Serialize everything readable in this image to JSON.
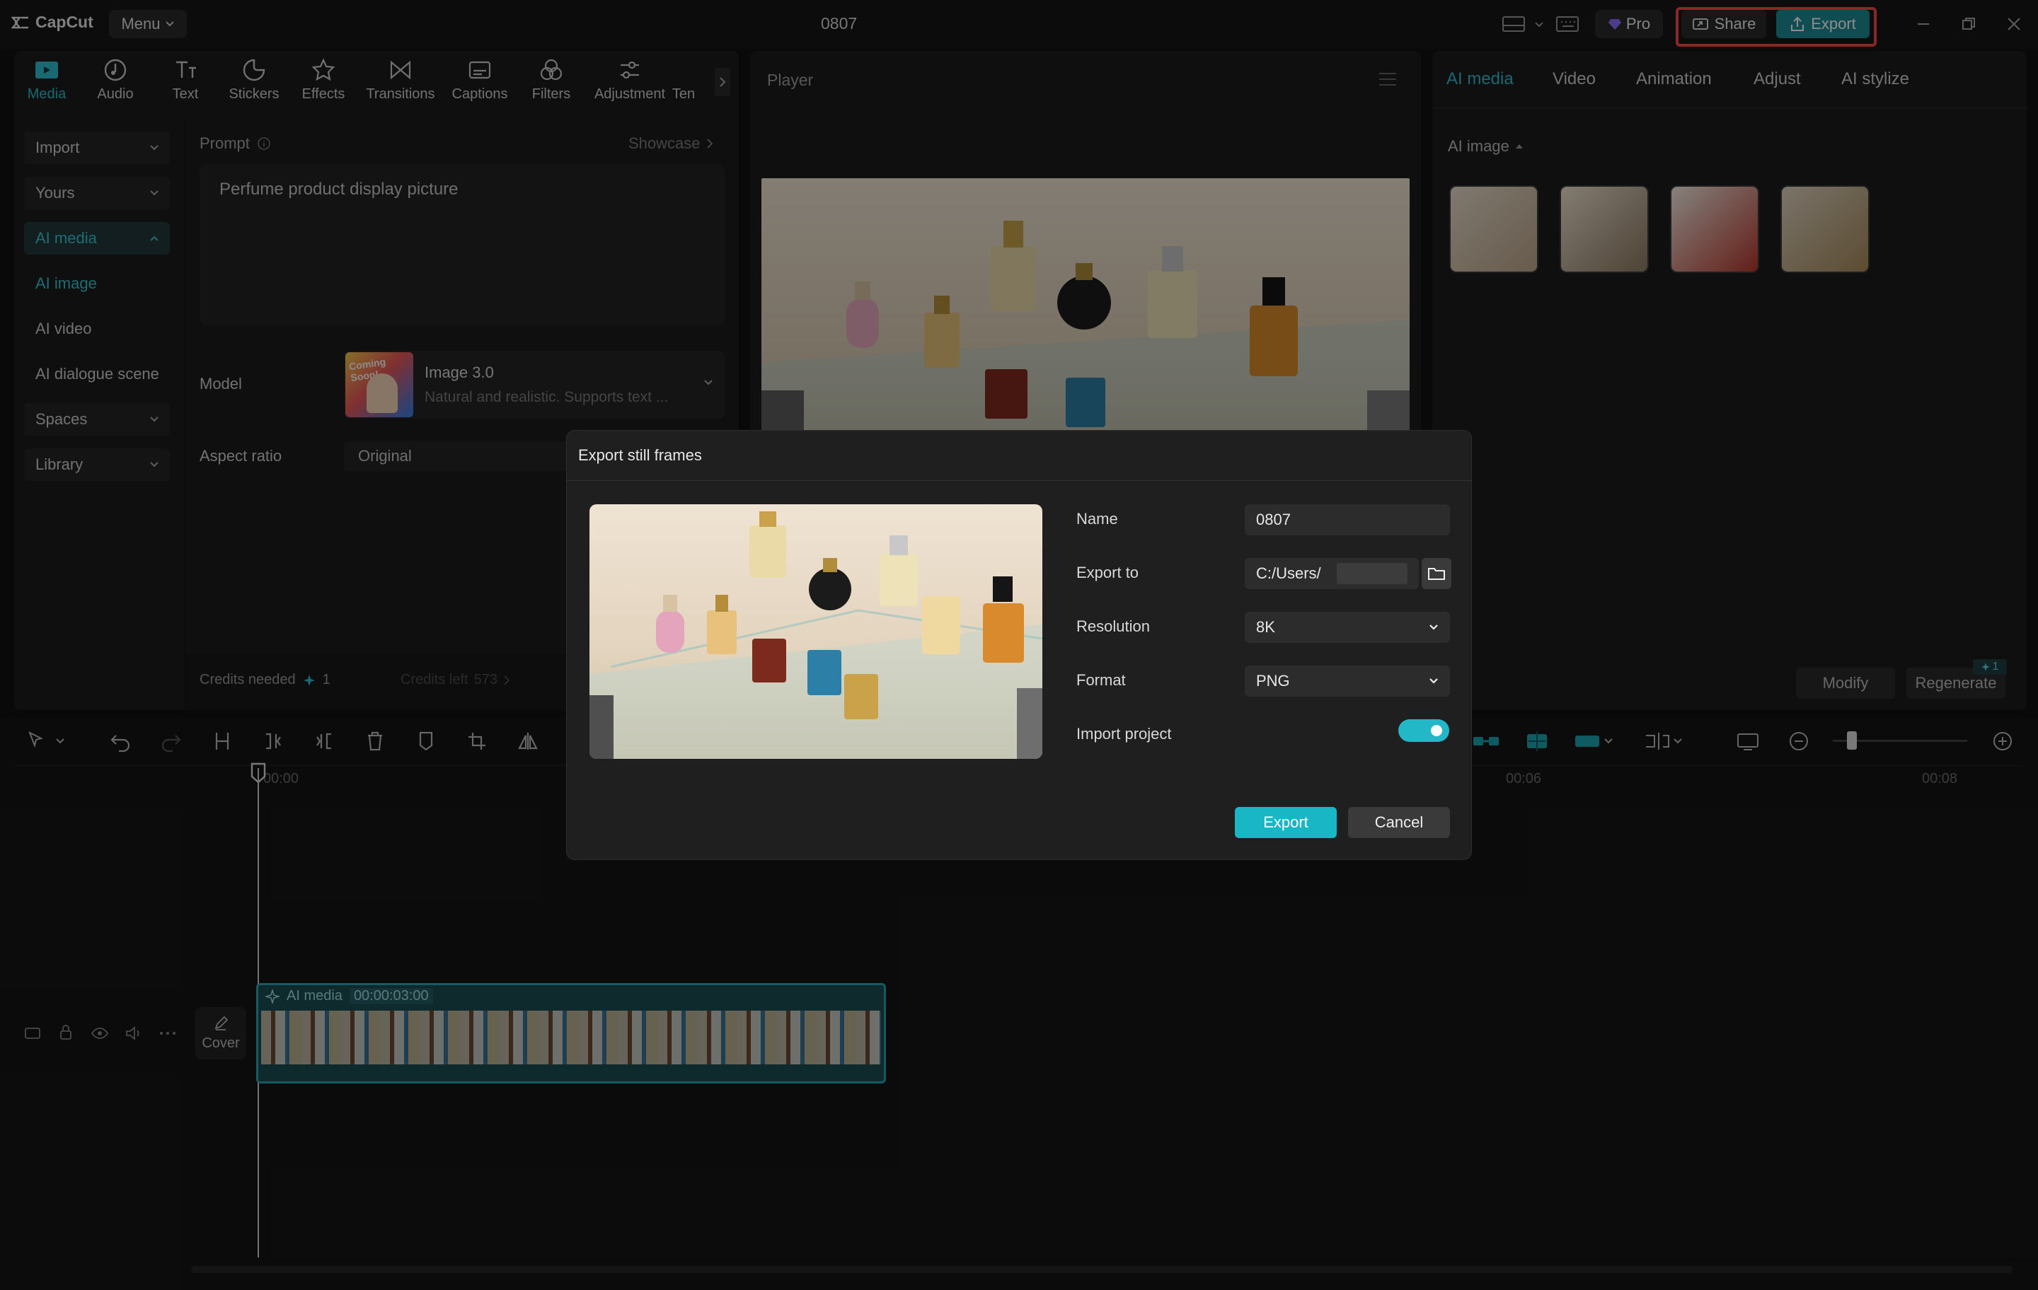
{
  "app": {
    "name": "CapCut",
    "menu_label": "Menu",
    "project_title": "0807"
  },
  "titlebar": {
    "pro_label": "Pro",
    "share_label": "Share",
    "export_label": "Export"
  },
  "tools": [
    "Media",
    "Audio",
    "Text",
    "Stickers",
    "Effects",
    "Transitions",
    "Captions",
    "Filters",
    "Adjustment",
    "Ten"
  ],
  "sidenav": {
    "import": "Import",
    "yours": "Yours",
    "ai_media": "AI media",
    "ai_image": "AI image",
    "ai_video": "AI video",
    "ai_dialogue": "AI dialogue scene",
    "spaces": "Spaces",
    "library": "Library"
  },
  "generator": {
    "prompt_label": "Prompt",
    "showcase": "Showcase",
    "prompt_text": "Perfume product display picture",
    "model_label": "Model",
    "model_name": "Image 3.0",
    "model_desc": "Natural and realistic. Supports text ...",
    "model_badge": "Coming Soon!",
    "aspect_label": "Aspect ratio",
    "aspect_value": "Original",
    "credits_needed": "Credits needed",
    "credits_needed_value": "1",
    "credits_left": "Credits left",
    "credits_left_value": "573"
  },
  "player": {
    "title": "Player"
  },
  "right": {
    "tabs": [
      "AI media",
      "Video",
      "Animation",
      "Adjust",
      "AI stylize"
    ],
    "section": "AI image",
    "modify": "Modify",
    "regenerate": "Regenerate",
    "regen_badge": "1"
  },
  "timeline": {
    "ruler": [
      "00:00",
      "00:06",
      "00:08"
    ],
    "clip_label": "AI media",
    "clip_duration": "00:00:03:00",
    "cover_label": "Cover"
  },
  "dialog": {
    "title": "Export still frames",
    "name_label": "Name",
    "name_value": "0807",
    "export_to_label": "Export to",
    "export_to_value": "C:/Users/",
    "resolution_label": "Resolution",
    "resolution_value": "8K",
    "format_label": "Format",
    "format_value": "PNG",
    "import_label": "Import project",
    "import_on": true,
    "export_btn": "Export",
    "cancel_btn": "Cancel"
  },
  "colors": {
    "accent": "#19b6c5",
    "highlight": "#ff4747",
    "bg": "#121212"
  }
}
